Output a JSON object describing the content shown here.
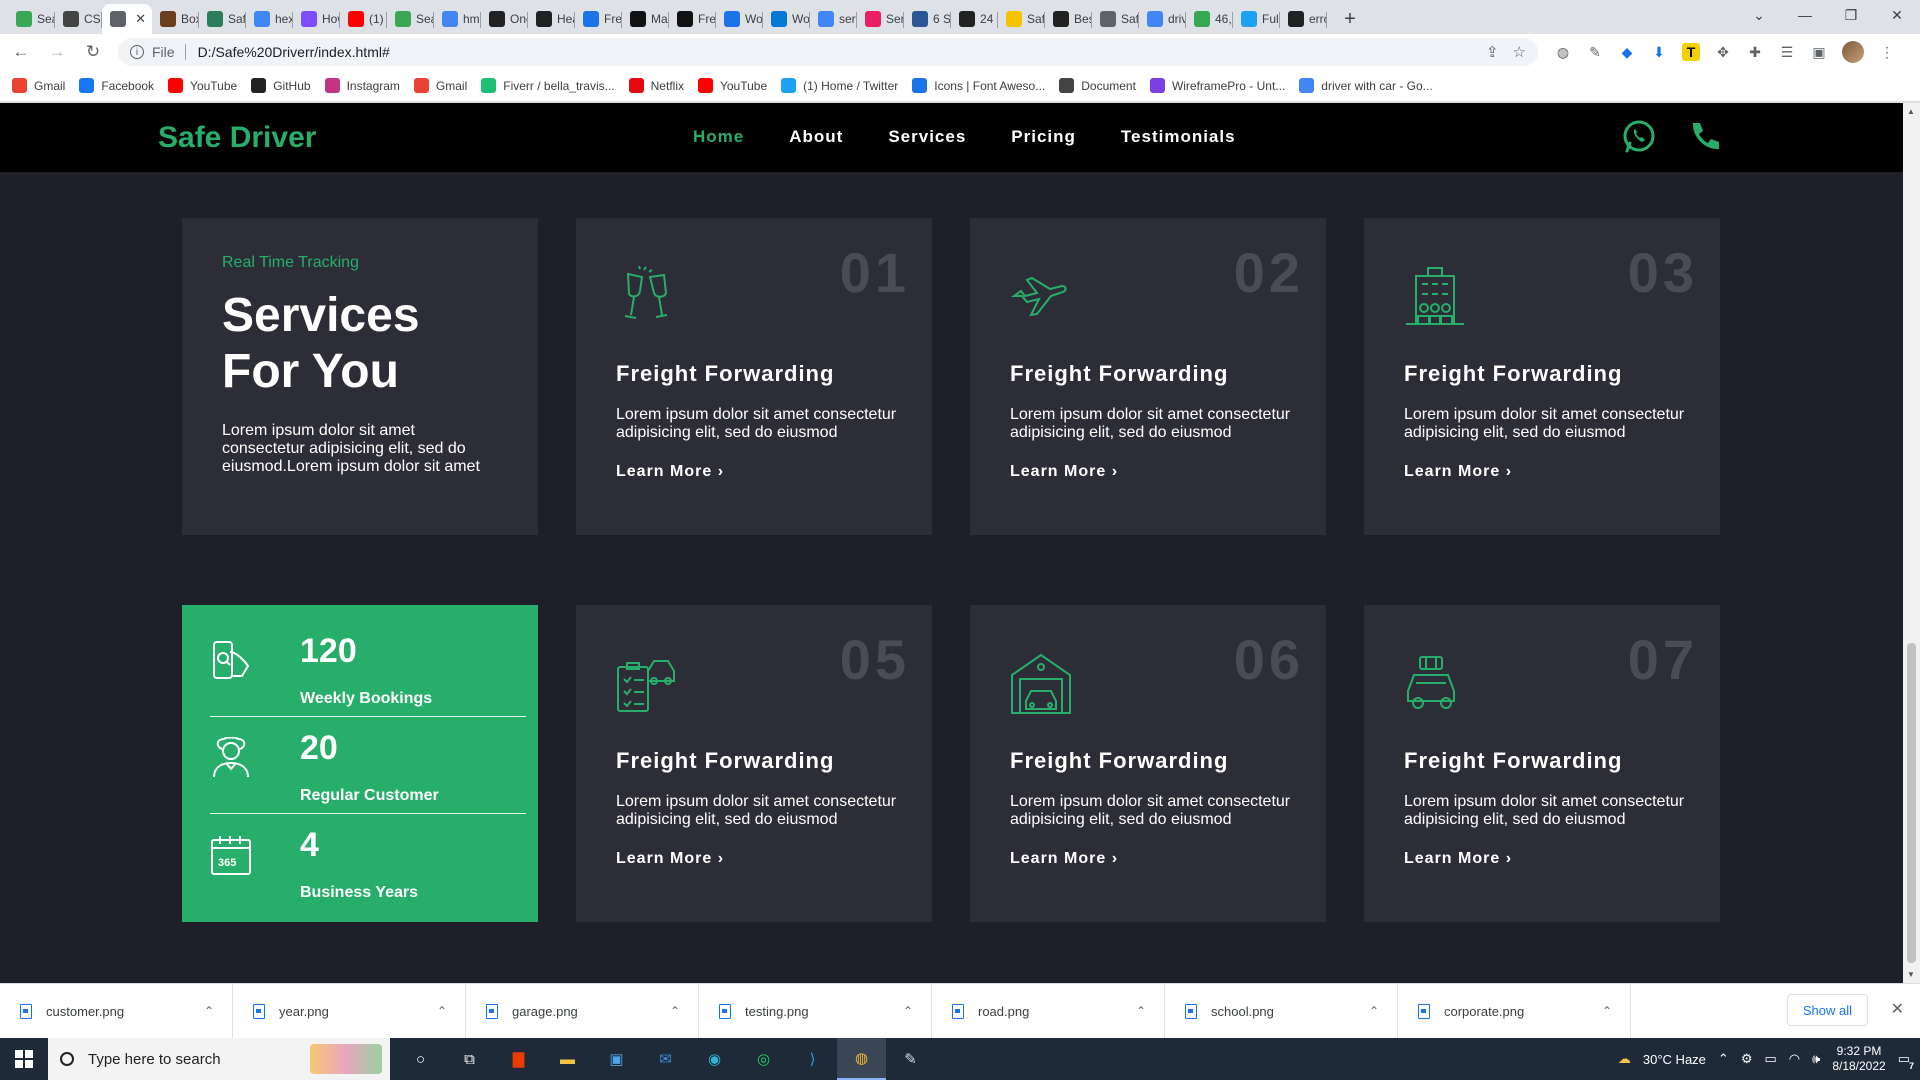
{
  "browser": {
    "tabs": [
      {
        "label": "Sea",
        "color": "#3aa757"
      },
      {
        "label": "CSS",
        "color": "#444444"
      },
      {
        "label": "",
        "color": "#5f6368",
        "active": true
      },
      {
        "label": "Box",
        "color": "#6b3e1e"
      },
      {
        "label": "Safe",
        "color": "#2d7d5a"
      },
      {
        "label": "hex",
        "color": "#4285f4"
      },
      {
        "label": "How",
        "color": "#7c4dff"
      },
      {
        "label": "(1)",
        "color": "#ff0000"
      },
      {
        "label": "Sea",
        "color": "#3aa757"
      },
      {
        "label": "hm",
        "color": "#4285f4"
      },
      {
        "label": "One",
        "color": "#222222"
      },
      {
        "label": "Hea",
        "color": "#222222"
      },
      {
        "label": "Free",
        "color": "#1a73e8"
      },
      {
        "label": "Ma",
        "color": "#111111"
      },
      {
        "label": "Free",
        "color": "#111111"
      },
      {
        "label": "Wo",
        "color": "#1a73e8"
      },
      {
        "label": "Wo",
        "color": "#0078d4"
      },
      {
        "label": "serv",
        "color": "#4285f4"
      },
      {
        "label": "Ser",
        "color": "#e91e63"
      },
      {
        "label": "6 S",
        "color": "#2b5797"
      },
      {
        "label": "24",
        "color": "#222222"
      },
      {
        "label": "Saf",
        "color": "#f5c400"
      },
      {
        "label": "Bes",
        "color": "#222222"
      },
      {
        "label": "Saf",
        "color": "#5f6368"
      },
      {
        "label": "driv",
        "color": "#4285f4"
      },
      {
        "label": "46,",
        "color": "#34a853"
      },
      {
        "label": "Full",
        "color": "#1da1f2"
      },
      {
        "label": "erro",
        "color": "#222222"
      }
    ],
    "active_close": "✕",
    "new_tab": "+",
    "window_controls": [
      "⌄",
      "—",
      "❐",
      "✕"
    ],
    "url_scheme": "File",
    "url": "D:/Safe%20Driverr/index.html#",
    "bookmarks": [
      {
        "label": "Gmail",
        "color": "#ea4335"
      },
      {
        "label": "Facebook",
        "color": "#1877f2"
      },
      {
        "label": "YouTube",
        "color": "#ff0000"
      },
      {
        "label": "GitHub",
        "color": "#222222"
      },
      {
        "label": "Instagram",
        "color": "#c13584"
      },
      {
        "label": "Gmail",
        "color": "#ea4335"
      },
      {
        "label": "Fiverr / bella_travis...",
        "color": "#1dbf73"
      },
      {
        "label": "Netflix",
        "color": "#e50914"
      },
      {
        "label": "YouTube",
        "color": "#ff0000"
      },
      {
        "label": "(1) Home / Twitter",
        "color": "#1da1f2"
      },
      {
        "label": "Icons | Font Aweso...",
        "color": "#1a73e8"
      },
      {
        "label": "Document",
        "color": "#444444"
      },
      {
        "label": "WireframePro - Unt...",
        "color": "#7b3fe4"
      },
      {
        "label": "driver with car - Go...",
        "color": "#4285f4"
      }
    ]
  },
  "site": {
    "logo": "Safe Driver",
    "nav": [
      "Home",
      "About",
      "Services",
      "Pricing",
      "Testimonials"
    ],
    "accent": "#27ae6a",
    "intro": {
      "eyebrow": "Real Time Tracking",
      "title": "Services For You",
      "text": "Lorem ipsum dolor sit amet consectetur adipisicing elit, sed do eiusmod.Lorem ipsum dolor sit amet"
    },
    "services": [
      {
        "num": "01",
        "icon": "cheers-glasses-icon",
        "title": "Freight Forwarding",
        "text": "Lorem ipsum dolor sit amet consectetur adipisicing elit, sed do eiusmod",
        "cta": "Learn More ›"
      },
      {
        "num": "02",
        "icon": "airplane-icon",
        "title": "Freight Forwarding",
        "text": "Lorem ipsum dolor sit amet consectetur adipisicing elit, sed do eiusmod",
        "cta": "Learn More ›"
      },
      {
        "num": "03",
        "icon": "corporate-building-icon",
        "title": "Freight Forwarding",
        "text": "Lorem ipsum dolor sit amet consectetur adipisicing elit, sed do eiusmod",
        "cta": "Learn More ›"
      },
      {
        "num": "05",
        "icon": "driving-test-checklist-icon",
        "title": "Freight Forwarding",
        "text": "Lorem ipsum dolor sit amet consectetur adipisicing elit, sed do eiusmod",
        "cta": "Learn More ›"
      },
      {
        "num": "06",
        "icon": "garage-icon",
        "title": "Freight Forwarding",
        "text": "Lorem ipsum dolor sit amet consectetur adipisicing elit, sed do eiusmod",
        "cta": "Learn More ›"
      },
      {
        "num": "07",
        "icon": "road-trip-car-icon",
        "title": "Freight Forwarding",
        "text": "Lorem ipsum dolor sit amet consectetur adipisicing elit, sed do eiusmod",
        "cta": "Learn More ›"
      }
    ],
    "stats": [
      {
        "value": "120",
        "label": "Weekly Bookings",
        "icon": "booking-phone-icon"
      },
      {
        "value": "20",
        "label": "Regular Customer",
        "icon": "customer-icon"
      },
      {
        "value": "4",
        "label": "Business Years",
        "icon": "calendar-365-icon"
      }
    ]
  },
  "downloads": {
    "files": [
      "customer.png",
      "year.png",
      "garage.png",
      "testing.png",
      "road.png",
      "school.png",
      "corporate.png"
    ],
    "show_all": "Show all"
  },
  "taskbar": {
    "search_placeholder": "Type here to search",
    "weather": "30°C  Haze",
    "time": "9:32 PM",
    "date": "8/18/2022",
    "notifications": "7"
  }
}
